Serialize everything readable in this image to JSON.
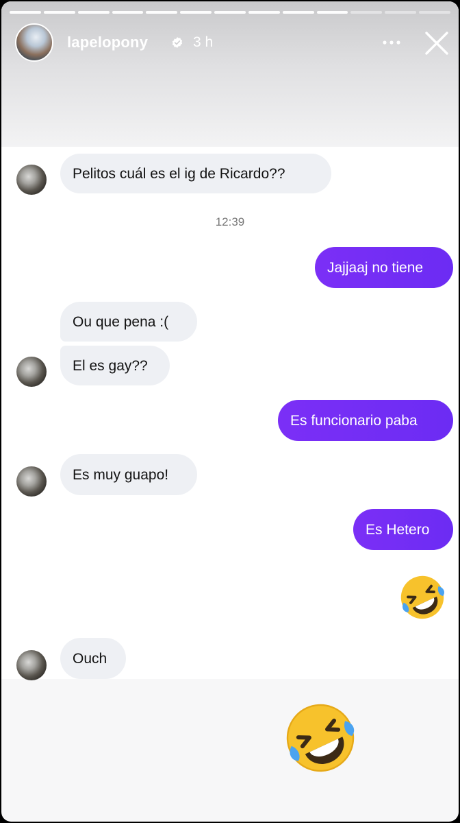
{
  "story": {
    "username": "lapelopony",
    "time_ago": "3 h",
    "progress_segments": 13,
    "progress_viewed": 10
  },
  "chat": {
    "messages": [
      {
        "from": "them",
        "text": "Pelitos cuál es el ig de Ricardo??"
      },
      {
        "from": "me",
        "text": "Jajjaaj no tiene"
      },
      {
        "from": "them",
        "text": "Ou que pena :("
      },
      {
        "from": "them",
        "text": "El es gay??"
      },
      {
        "from": "me",
        "text": "Es funcionario paba"
      },
      {
        "from": "them",
        "text": "Es muy guapo!"
      },
      {
        "from": "me",
        "text": "Es Hetero"
      },
      {
        "from": "me",
        "emoji": "rolling-on-the-floor-laughing"
      },
      {
        "from": "them",
        "text": "Ouch"
      }
    ],
    "timestamp": "12:39"
  },
  "sticker": {
    "emoji": "rolling-on-the-floor-laughing"
  },
  "icons": {
    "verified": "verified-badge-icon",
    "more": "more-options-icon",
    "close": "close-icon"
  },
  "colors": {
    "outgoing_bubble": "#7a2ff4",
    "incoming_bubble": "#eef0f4",
    "emoji_yellow": "#f7c22c"
  }
}
